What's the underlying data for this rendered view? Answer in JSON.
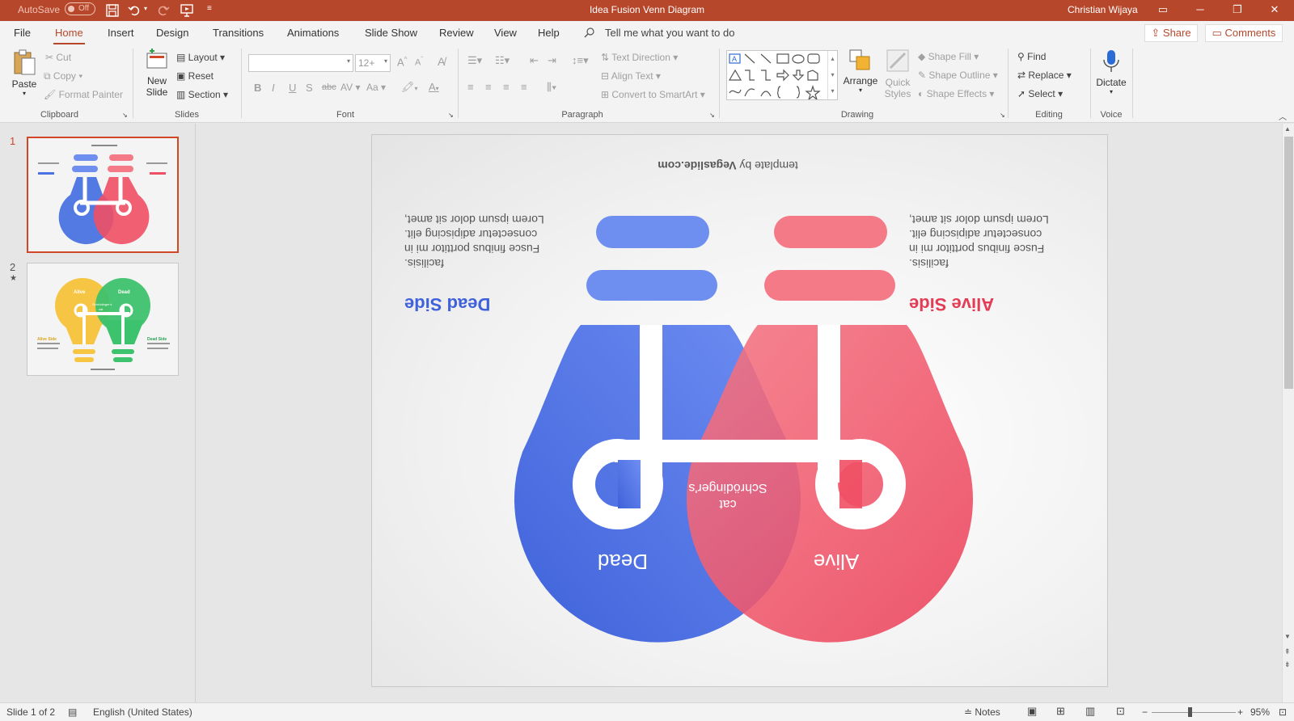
{
  "titlebar": {
    "autosave_label": "AutoSave",
    "autosave_state": "Off",
    "doc_title": "Idea Fusion Venn Diagram",
    "user": "Christian Wijaya"
  },
  "tabs": {
    "items": [
      "File",
      "Home",
      "Insert",
      "Design",
      "Transitions",
      "Animations",
      "Slide Show",
      "Review",
      "View",
      "Help"
    ],
    "active": "Home",
    "tell_me": "Tell me what you want to do",
    "share": "Share",
    "comments": "Comments"
  },
  "ribbon": {
    "clipboard": {
      "paste": "Paste",
      "cut": "Cut",
      "copy": "Copy",
      "format_painter": "Format Painter",
      "label": "Clipboard"
    },
    "slides": {
      "new_slide_1": "New",
      "new_slide_2": "Slide",
      "layout": "Layout",
      "reset": "Reset",
      "section": "Section",
      "label": "Slides"
    },
    "font": {
      "font_name": "",
      "font_size": "12+",
      "bold": "B",
      "italic": "I",
      "underline": "U",
      "shadow": "S",
      "strike": "abc",
      "spacing": "AV",
      "case": "Aa",
      "label": "Font"
    },
    "paragraph": {
      "text_direction": "Text Direction",
      "align_text": "Align Text",
      "convert_smartart": "Convert to SmartArt",
      "label": "Paragraph"
    },
    "drawing": {
      "arrange": "Arrange",
      "quick_styles_1": "Quick",
      "quick_styles_2": "Styles",
      "shape_fill": "Shape Fill",
      "shape_outline": "Shape Outline",
      "shape_effects": "Shape Effects",
      "label": "Drawing"
    },
    "editing": {
      "find": "Find",
      "replace": "Replace",
      "select": "Select",
      "label": "Editing"
    },
    "voice": {
      "dictate": "Dictate",
      "label": "Voice"
    }
  },
  "thumbnails": [
    {
      "number": "1",
      "selected": true
    },
    {
      "number": "2",
      "star": "★",
      "selected": false
    }
  ],
  "slide": {
    "credit_prefix": "template by ",
    "credit_brand": "Vegaslide.com",
    "left_heading": "Dead Side",
    "left_body_1": "Lorem ipsum dolor sit amet,",
    "left_body_2": "consectetur adipiscing elit.",
    "left_body_3": "Fusce finibus porttitor mi in",
    "left_body_4": "facilisis.",
    "right_heading": "Alive Side",
    "right_body_1": "Lorem ipsum dolor sit amet,",
    "right_body_2": "consectetur adipiscing elit.",
    "right_body_3": "Fusce finibus porttitor mi in",
    "right_body_4": "facilisis.",
    "center_label_1": "Schrödinger's",
    "center_label_2": "cat",
    "left_bulb_label": "Dead",
    "right_bulb_label": "Alive",
    "colors": {
      "blue": "#4a72e2",
      "red": "#ef4f64",
      "blue_light": "#6f8ff0",
      "red_light": "#f57a88"
    }
  },
  "thumb2": {
    "left_label": "Alive",
    "right_label": "Dead",
    "center_1": "Schrödinger's",
    "center_2": "cat",
    "left_heading": "Alive Side",
    "right_heading": "Dead Side",
    "colors": {
      "yellow": "#f6c543",
      "green": "#3dc26d"
    }
  },
  "statusbar": {
    "slide_info": "Slide 1 of 2",
    "language": "English (United States)",
    "notes": "Notes",
    "zoom": "95%"
  }
}
